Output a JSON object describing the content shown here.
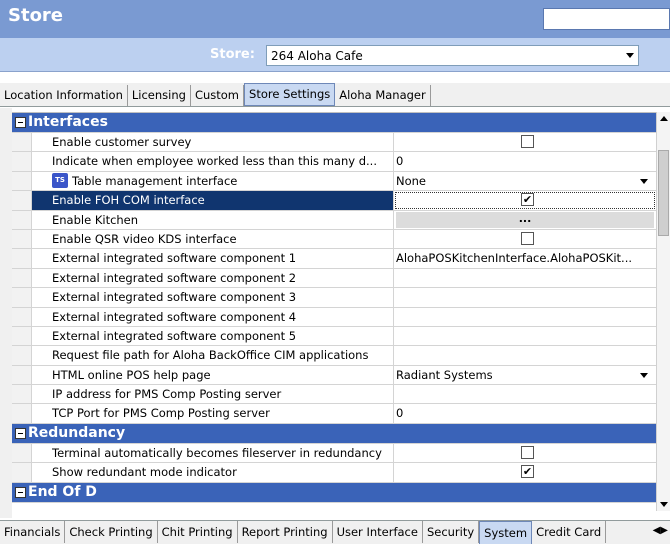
{
  "window": {
    "title": "Store"
  },
  "store": {
    "label": "Store:",
    "value": "264 Aloha Cafe"
  },
  "top_tabs": [
    "Location Information",
    "Licensing",
    "Custom",
    "Store Settings",
    "Aloha Manager"
  ],
  "top_active": "Store Settings",
  "bottom_tabs": [
    "Financials",
    "Check Printing",
    "Chit Printing",
    "Report Printing",
    "User Interface",
    "Security",
    "System",
    "Credit Card"
  ],
  "bottom_active": "System",
  "sections": [
    {
      "title": "Interfaces",
      "rows": [
        {
          "name": "Enable customer survey",
          "type": "checkbox",
          "checked": false
        },
        {
          "name": "Indicate when employee worked less than this many d...",
          "type": "text",
          "value": "0"
        },
        {
          "name": "Table management interface",
          "type": "dropdown",
          "value": "None",
          "icon": "ts-icon"
        },
        {
          "name": "Enable FOH COM interface",
          "type": "checkbox",
          "checked": true,
          "selected": true
        },
        {
          "name": "Enable Kitchen",
          "type": "button",
          "value": "..."
        },
        {
          "name": "Enable QSR video KDS interface",
          "type": "checkbox",
          "checked": false
        },
        {
          "name": "External integrated software component 1",
          "type": "text",
          "value": "AlohaPOSKitchenInterface.AlohaPOSKit..."
        },
        {
          "name": "External integrated software component 2",
          "type": "text",
          "value": ""
        },
        {
          "name": "External integrated software component 3",
          "type": "text",
          "value": ""
        },
        {
          "name": "External integrated software component 4",
          "type": "text",
          "value": ""
        },
        {
          "name": "External integrated software component 5",
          "type": "text",
          "value": ""
        },
        {
          "name": "Request file path for Aloha BackOffice CIM applications",
          "type": "text",
          "value": ""
        },
        {
          "name": "HTML online POS help page",
          "type": "dropdown",
          "value": "Radiant Systems"
        },
        {
          "name": "IP address for PMS Comp Posting server",
          "type": "text",
          "value": ""
        },
        {
          "name": "TCP Port for PMS Comp Posting server",
          "type": "text",
          "value": "0"
        }
      ]
    },
    {
      "title": "Redundancy",
      "rows": [
        {
          "name": "Terminal automatically becomes fileserver in redundancy",
          "type": "checkbox",
          "checked": false
        },
        {
          "name": "Show redundant mode indicator",
          "type": "checkbox",
          "checked": true
        }
      ]
    },
    {
      "title": "End Of D",
      "rows": []
    }
  ]
}
